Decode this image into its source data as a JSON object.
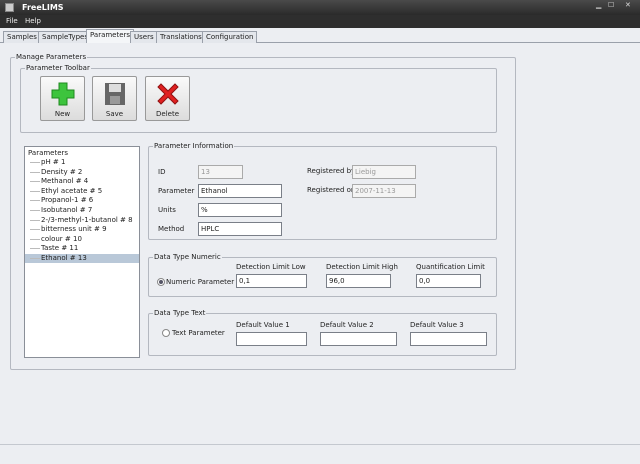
{
  "window": {
    "title": "FreeLIMS"
  },
  "menu": [
    "File",
    "Help"
  ],
  "tabs": [
    "Samples",
    "SampleTypes",
    "Parameters",
    "Users",
    "Translations",
    "Configuration"
  ],
  "active_tab": "Parameters",
  "manage": {
    "title": "Manage Parameters",
    "toolbar_title": "Parameter Toolbar",
    "buttons": {
      "new": "New",
      "save": "Save",
      "delete": "Delete"
    }
  },
  "tree": {
    "root": "Parameters",
    "items": [
      "pH # 1",
      "Density # 2",
      "Methanol # 4",
      "Ethyl acetate # 5",
      "Propanol-1 # 6",
      "Isobutanol # 7",
      "2-/3-methyl-1-butanol # 8",
      "bitterness unit # 9",
      "colour # 10",
      "Taste # 11",
      "Ethanol # 13"
    ],
    "selected": "Ethanol # 13"
  },
  "info": {
    "title": "Parameter Information",
    "id_label": "ID",
    "id": "13",
    "parameter_label": "Parameter",
    "parameter": "Ethanol",
    "units_label": "Units",
    "units": "%",
    "method_label": "Method",
    "method": "HPLC",
    "registered_by_label": "Registered by",
    "registered_by": "Liebig",
    "registered_on_label": "Registered on",
    "registered_on": "2007-11-13"
  },
  "numeric": {
    "title": "Data Type Numeric",
    "radio": "Numeric Parameter",
    "low_label": "Detection Limit Low",
    "low": "0,1",
    "high_label": "Detection Limit High",
    "high": "96,0",
    "quant_label": "Quantification Limit",
    "quant": "0,0"
  },
  "text": {
    "title": "Data Type Text",
    "radio": "Text Parameter",
    "d1_label": "Default Value 1",
    "d1": "",
    "d2_label": "Default Value 2",
    "d2": "",
    "d3_label": "Default Value 3",
    "d3": ""
  }
}
